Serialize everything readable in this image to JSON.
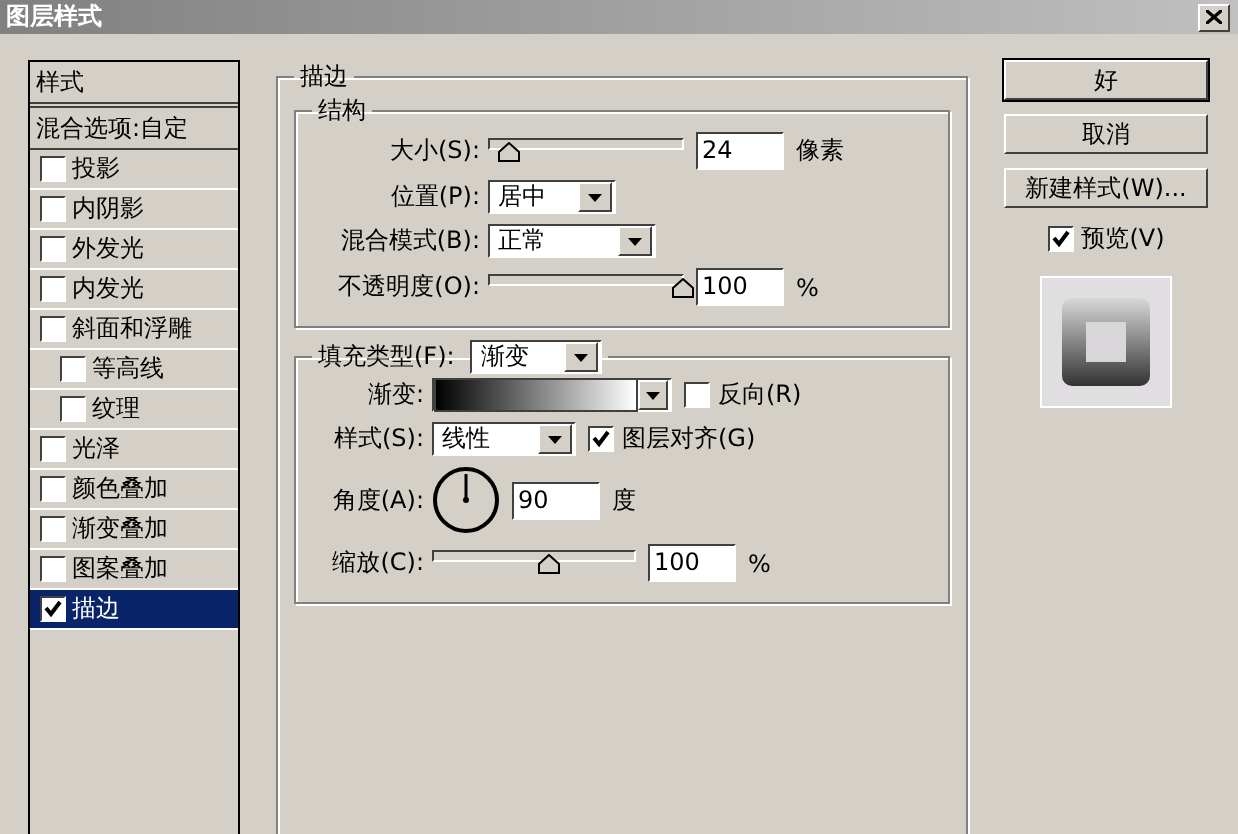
{
  "window": {
    "title": "图层样式"
  },
  "styles_panel": {
    "header": "样式",
    "blend_item": {
      "label": "混合选项:自定",
      "selected": false
    },
    "items": [
      {
        "label": "投影",
        "checked": false,
        "selected": false
      },
      {
        "label": "内阴影",
        "checked": false,
        "selected": false
      },
      {
        "label": "外发光",
        "checked": false,
        "selected": false
      },
      {
        "label": "内发光",
        "checked": false,
        "selected": false
      },
      {
        "label": "斜面和浮雕",
        "checked": false,
        "selected": false,
        "children": [
          {
            "label": "等高线",
            "checked": false,
            "selected": false
          },
          {
            "label": "纹理",
            "checked": false,
            "selected": false
          }
        ]
      },
      {
        "label": "光泽",
        "checked": false,
        "selected": false
      },
      {
        "label": "颜色叠加",
        "checked": false,
        "selected": false
      },
      {
        "label": "渐变叠加",
        "checked": false,
        "selected": false
      },
      {
        "label": "图案叠加",
        "checked": false,
        "selected": false
      },
      {
        "label": "描边",
        "checked": true,
        "selected": true
      }
    ]
  },
  "stroke": {
    "title": "描边",
    "structure": {
      "title": "结构",
      "size": {
        "label": "大小(S):",
        "level": 0.09,
        "value": "24",
        "unit": "像素"
      },
      "position": {
        "label": "位置(P):",
        "value": "居中"
      },
      "blend_mode": {
        "label": "混合模式(B):",
        "value": "正常"
      },
      "opacity": {
        "label": "不透明度(O):",
        "level": 1,
        "value": "100",
        "unit": "%"
      }
    },
    "fill": {
      "label": "填充类型(F):",
      "value": "渐变",
      "gradient": {
        "label": "渐变:"
      },
      "reverse": {
        "label": "反向(R)",
        "checked": false
      },
      "style": {
        "label": "样式(S):",
        "value": "线性"
      },
      "align": {
        "label": "图层对齐(G)",
        "checked": true
      },
      "angle": {
        "label": "角度(A):",
        "value": "90",
        "unit": "度"
      },
      "scale": {
        "label": "缩放(C):",
        "level": 0.57,
        "value": "100",
        "unit": "%"
      }
    }
  },
  "buttons": [
    {
      "label": "好",
      "default": true
    },
    {
      "label": "取消",
      "default": false
    },
    {
      "label": "新建样式(W)...",
      "default": false
    }
  ],
  "preview": {
    "label": "预览(V)",
    "checked": true
  }
}
